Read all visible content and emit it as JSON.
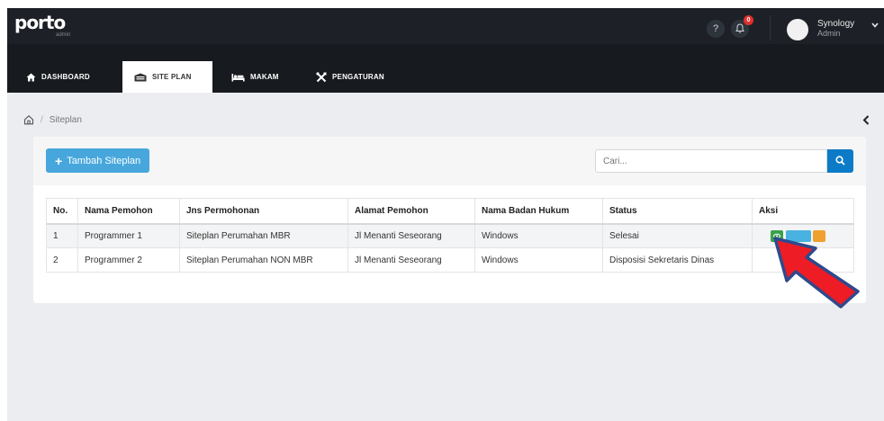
{
  "header": {
    "logo_text": "porto",
    "logo_subtitle": "admin",
    "help_label": "?",
    "notification_count": "0",
    "user_name": "Synology",
    "user_role": "Admin"
  },
  "nav": {
    "tabs": [
      {
        "label": "DASHBOARD",
        "icon": "home-icon",
        "active": false
      },
      {
        "label": "SITE PLAN",
        "icon": "building-icon",
        "active": true
      },
      {
        "label": "MAKAM",
        "icon": "bed-icon",
        "active": false
      },
      {
        "label": "PENGATURAN",
        "icon": "tools-icon",
        "active": false
      }
    ]
  },
  "breadcrumb": {
    "current": "Siteplan"
  },
  "toolbar": {
    "add_label": "Tambah Siteplan",
    "search_placeholder": "Cari..."
  },
  "table": {
    "columns": [
      "No.",
      "Nama Pemohon",
      "Jns Permohonan",
      "Alamat Pemohon",
      "Nama Badan Hukum",
      "Status",
      "Aksi"
    ],
    "rows": [
      {
        "no": "1",
        "nama": "Programmer 1",
        "jenis": "Siteplan Perumahan MBR",
        "alamat": "Jl Menanti Seseorang",
        "badan": "Windows",
        "status": "Selesai"
      },
      {
        "no": "2",
        "nama": "Programmer 2",
        "jenis": "Siteplan Perumahan NON MBR",
        "alamat": "Jl Menanti Seseorang",
        "badan": "Windows",
        "status": "Disposisi Sekretaris Dinas"
      }
    ]
  },
  "colors": {
    "header_bg": "#1d2127",
    "nav_bg": "#171a1e",
    "content_bg": "#ecedf0",
    "primary_button": "#47a7dc",
    "search_button": "#0b7bc7",
    "action_green": "#38a34a",
    "action_blue": "#48b2e0",
    "action_orange": "#f0a030",
    "badge_red": "#e3302f",
    "annotation_arrow_fill": "#ee1c24",
    "annotation_arrow_outline": "#2e4a8c"
  }
}
